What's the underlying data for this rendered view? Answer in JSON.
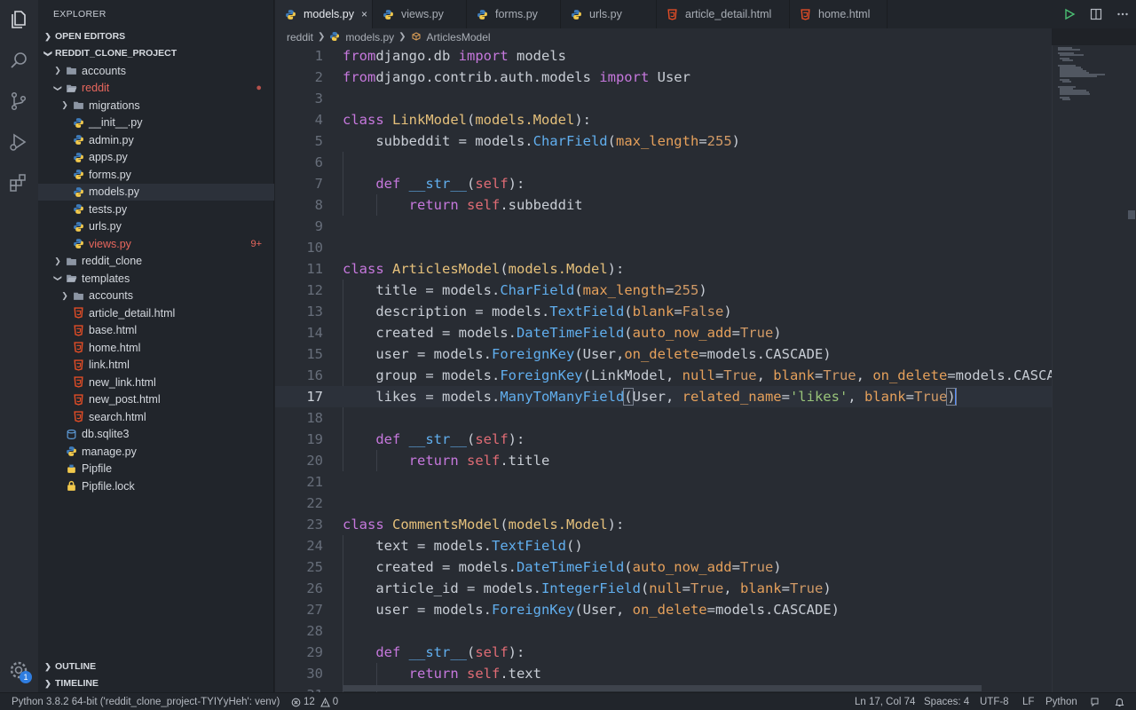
{
  "explorer": {
    "title": "EXPLORER",
    "open_editors": "OPEN EDITORS",
    "project": "REDDIT_CLONE_PROJECT",
    "outline": "OUTLINE",
    "timeline": "TIMELINE",
    "tree": [
      {
        "label": "accounts",
        "kind": "folder",
        "depth": 0,
        "arrow": "right"
      },
      {
        "label": "reddit",
        "kind": "folder-open",
        "depth": 0,
        "arrow": "down",
        "color": "#e8675d",
        "flag": "●",
        "flag_color": "#b6514b"
      },
      {
        "label": "migrations",
        "kind": "folder",
        "depth": 1,
        "arrow": "right"
      },
      {
        "label": "__init__.py",
        "kind": "python",
        "depth": 1
      },
      {
        "label": "admin.py",
        "kind": "python",
        "depth": 1
      },
      {
        "label": "apps.py",
        "kind": "python",
        "depth": 1
      },
      {
        "label": "forms.py",
        "kind": "python",
        "depth": 1
      },
      {
        "label": "models.py",
        "kind": "python",
        "depth": 1,
        "active": true
      },
      {
        "label": "tests.py",
        "kind": "python",
        "depth": 1
      },
      {
        "label": "urls.py",
        "kind": "python",
        "depth": 1
      },
      {
        "label": "views.py",
        "kind": "python",
        "depth": 1,
        "color": "#e8675d",
        "flag": "9+",
        "flag_color": "#e8675d"
      },
      {
        "label": "reddit_clone",
        "kind": "folder",
        "depth": 0,
        "arrow": "right"
      },
      {
        "label": "templates",
        "kind": "folder-open",
        "depth": 0,
        "arrow": "down"
      },
      {
        "label": "accounts",
        "kind": "folder",
        "depth": 1,
        "arrow": "right"
      },
      {
        "label": "article_detail.html",
        "kind": "html",
        "depth": 1
      },
      {
        "label": "base.html",
        "kind": "html",
        "depth": 1
      },
      {
        "label": "home.html",
        "kind": "html",
        "depth": 1
      },
      {
        "label": "link.html",
        "kind": "html",
        "depth": 1
      },
      {
        "label": "new_link.html",
        "kind": "html",
        "depth": 1
      },
      {
        "label": "new_post.html",
        "kind": "html",
        "depth": 1
      },
      {
        "label": "search.html",
        "kind": "html",
        "depth": 1
      },
      {
        "label": "db.sqlite3",
        "kind": "db",
        "depth": 0
      },
      {
        "label": "manage.py",
        "kind": "python",
        "depth": 0
      },
      {
        "label": "Pipfile",
        "kind": "pipfile",
        "depth": 0
      },
      {
        "label": "Pipfile.lock",
        "kind": "lock",
        "depth": 0
      }
    ]
  },
  "tabs": [
    {
      "label": "models.py",
      "kind": "python",
      "active": true,
      "close": "×"
    },
    {
      "label": "views.py",
      "kind": "python"
    },
    {
      "label": "forms.py",
      "kind": "python"
    },
    {
      "label": "urls.py",
      "kind": "python"
    },
    {
      "label": "article_detail.html",
      "kind": "html"
    },
    {
      "label": "home.html",
      "kind": "html"
    }
  ],
  "breadcrumb": {
    "folder": "reddit",
    "file": "models.py",
    "symbol": "ArticlesModel"
  },
  "editor": {
    "current_line": 17,
    "first_line": 1,
    "lines": [
      [
        [
          "kw",
          "from"
        ],
        [
          "",
          "django.db "
        ],
        [
          "kw",
          "import"
        ],
        [
          "",
          " models"
        ]
      ],
      [
        [
          "kw",
          "from"
        ],
        [
          "",
          "django.contrib.auth.models "
        ],
        [
          "kw",
          "import"
        ],
        [
          "",
          " User"
        ]
      ],
      [],
      [
        [
          "kw",
          "class "
        ],
        [
          "cls",
          "LinkModel"
        ],
        [
          "",
          "("
        ],
        [
          "cls",
          "models.Model"
        ],
        [
          "",
          "):"
        ]
      ],
      [
        [
          "",
          "    subbeddit = models."
        ],
        [
          "fn",
          "CharField"
        ],
        [
          "",
          "("
        ],
        [
          "prm",
          "max_length"
        ],
        [
          "",
          "="
        ],
        [
          "num",
          "255"
        ],
        [
          "",
          ")"
        ]
      ],
      [],
      [
        [
          "",
          "    "
        ],
        [
          "kw",
          "def "
        ],
        [
          "fn",
          "__str__"
        ],
        [
          "",
          "("
        ],
        [
          "self",
          "self"
        ],
        [
          "",
          "):"
        ]
      ],
      [
        [
          "",
          "        "
        ],
        [
          "kw",
          "return "
        ],
        [
          "self",
          "self"
        ],
        [
          "",
          ".subbeddit"
        ]
      ],
      [],
      [],
      [
        [
          "kw",
          "class "
        ],
        [
          "cls",
          "ArticlesModel"
        ],
        [
          "",
          "("
        ],
        [
          "cls",
          "models.Model"
        ],
        [
          "",
          "):"
        ]
      ],
      [
        [
          "",
          "    title = models."
        ],
        [
          "fn",
          "CharField"
        ],
        [
          "",
          "("
        ],
        [
          "prm",
          "max_length"
        ],
        [
          "",
          "="
        ],
        [
          "num",
          "255"
        ],
        [
          "",
          ")"
        ]
      ],
      [
        [
          "",
          "    description = models."
        ],
        [
          "fn",
          "TextField"
        ],
        [
          "",
          "("
        ],
        [
          "prm",
          "blank"
        ],
        [
          "",
          "="
        ],
        [
          "num",
          "False"
        ],
        [
          "",
          ")"
        ]
      ],
      [
        [
          "",
          "    created = models."
        ],
        [
          "fn",
          "DateTimeField"
        ],
        [
          "",
          "("
        ],
        [
          "prm",
          "auto_now_add"
        ],
        [
          "",
          "="
        ],
        [
          "num",
          "True"
        ],
        [
          "",
          ")"
        ]
      ],
      [
        [
          "",
          "    user = models."
        ],
        [
          "fn",
          "ForeignKey"
        ],
        [
          "",
          "(User,"
        ],
        [
          "prm",
          "on_delete"
        ],
        [
          "",
          "=models.CASCADE)"
        ]
      ],
      [
        [
          "",
          "    group = models."
        ],
        [
          "fn",
          "ForeignKey"
        ],
        [
          "",
          "(LinkModel, "
        ],
        [
          "prm",
          "null"
        ],
        [
          "",
          "="
        ],
        [
          "num",
          "True"
        ],
        [
          "",
          ", "
        ],
        [
          "prm",
          "blank"
        ],
        [
          "",
          "="
        ],
        [
          "num",
          "True"
        ],
        [
          "",
          ", "
        ],
        [
          "prm",
          "on_delete"
        ],
        [
          "",
          "=models.CASCADE)"
        ]
      ],
      [
        [
          "",
          "    likes = models."
        ],
        [
          "fn",
          "ManyToManyField"
        ],
        [
          "box",
          "("
        ],
        [
          "",
          "User, "
        ],
        [
          "prm",
          "related_name"
        ],
        [
          "",
          "="
        ],
        [
          "str",
          "'likes'"
        ],
        [
          "",
          ", "
        ],
        [
          "prm",
          "blank"
        ],
        [
          "",
          "="
        ],
        [
          "num",
          "True"
        ],
        [
          "box",
          ")"
        ]
      ],
      [],
      [
        [
          "",
          "    "
        ],
        [
          "kw",
          "def "
        ],
        [
          "fn",
          "__str__"
        ],
        [
          "",
          "("
        ],
        [
          "self",
          "self"
        ],
        [
          "",
          "):"
        ]
      ],
      [
        [
          "",
          "        "
        ],
        [
          "kw",
          "return "
        ],
        [
          "self",
          "self"
        ],
        [
          "",
          ".title"
        ]
      ],
      [],
      [],
      [
        [
          "kw",
          "class "
        ],
        [
          "cls",
          "CommentsModel"
        ],
        [
          "",
          "("
        ],
        [
          "cls",
          "models.Model"
        ],
        [
          "",
          "):"
        ]
      ],
      [
        [
          "",
          "    text = models."
        ],
        [
          "fn",
          "TextField"
        ],
        [
          "",
          "()"
        ]
      ],
      [
        [
          "",
          "    created = models."
        ],
        [
          "fn",
          "DateTimeField"
        ],
        [
          "",
          "("
        ],
        [
          "prm",
          "auto_now_add"
        ],
        [
          "",
          "="
        ],
        [
          "num",
          "True"
        ],
        [
          "",
          ")"
        ]
      ],
      [
        [
          "",
          "    article_id = models."
        ],
        [
          "fn",
          "IntegerField"
        ],
        [
          "",
          "("
        ],
        [
          "prm",
          "null"
        ],
        [
          "",
          "="
        ],
        [
          "num",
          "True"
        ],
        [
          "",
          ", "
        ],
        [
          "prm",
          "blank"
        ],
        [
          "",
          "="
        ],
        [
          "num",
          "True"
        ],
        [
          "",
          ")"
        ]
      ],
      [
        [
          "",
          "    user = models."
        ],
        [
          "fn",
          "ForeignKey"
        ],
        [
          "",
          "(User, "
        ],
        [
          "prm",
          "on_delete"
        ],
        [
          "",
          "=models.CASCADE)"
        ]
      ],
      [],
      [
        [
          "",
          "    "
        ],
        [
          "kw",
          "def "
        ],
        [
          "fn",
          "__str__"
        ],
        [
          "",
          "("
        ],
        [
          "self",
          "self"
        ],
        [
          "",
          "):"
        ]
      ],
      [
        [
          "",
          "        "
        ],
        [
          "kw",
          "return "
        ],
        [
          "self",
          "self"
        ],
        [
          "",
          ".text"
        ]
      ],
      []
    ]
  },
  "status": {
    "interpreter": "Python 3.8.2 64-bit ('reddit_clone_project-TYIYyHeh': venv)",
    "errors": "12",
    "warnings": "0",
    "position": "Ln 17, Col 74",
    "spaces": "Spaces: 4",
    "encoding": "UTF-8",
    "eol": "LF",
    "language": "Python"
  },
  "activity": {
    "badge": "1"
  },
  "icons": {
    "explorer": "files-icon",
    "search": "search-icon",
    "scm": "source-control-icon",
    "debug": "run-debug-icon",
    "extensions": "extensions-icon",
    "settings": "gear-icon"
  },
  "colors": {
    "accent": "#528bff",
    "error": "#e8675d",
    "python_blue": "#3d7ab8",
    "python_yellow": "#f2c94c",
    "html": "#e44d26"
  }
}
